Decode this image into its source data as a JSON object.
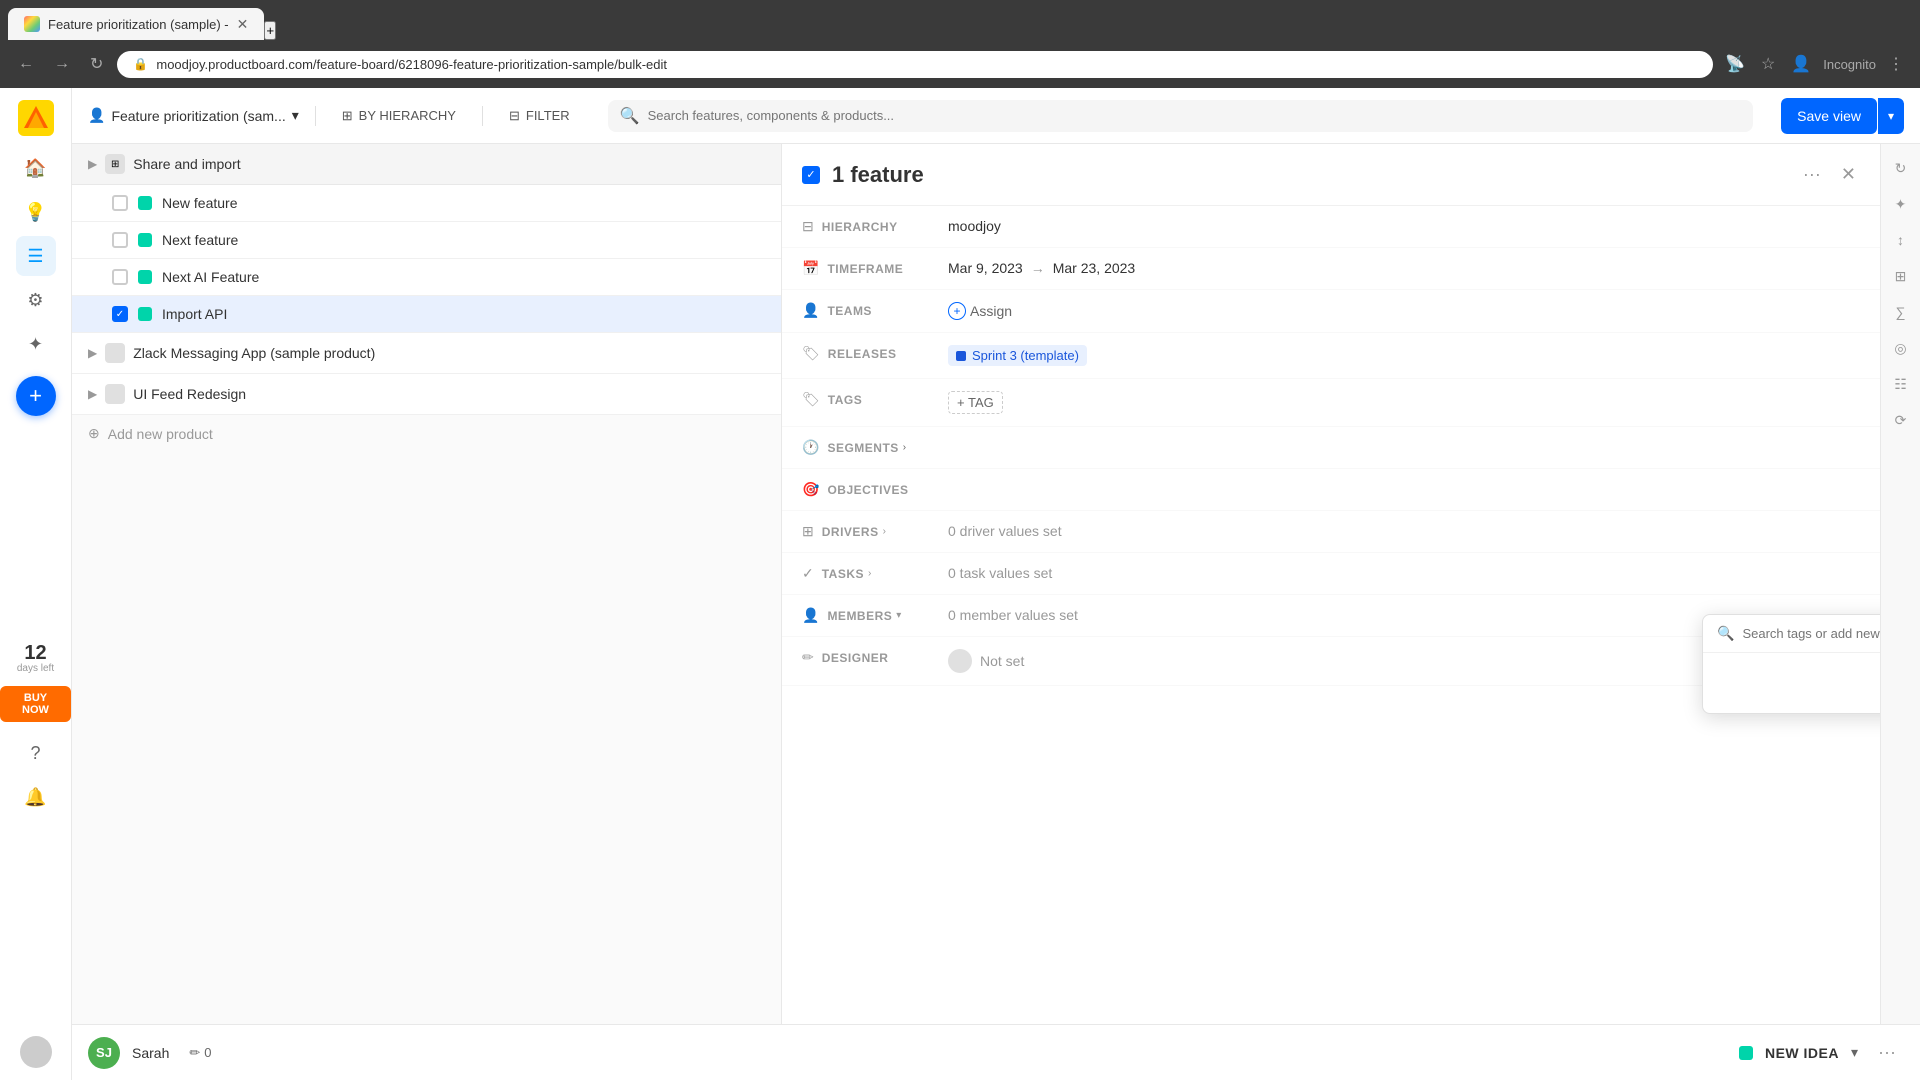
{
  "browser": {
    "tab_title": "Feature prioritization (sample) -",
    "tab_favicon": "🔶",
    "url": "moodjoy.productboard.com/feature-board/6218096-feature-prioritization-sample/bulk-edit",
    "incognito_label": "Incognito"
  },
  "toolbar": {
    "board_name": "Feature prioritization (sam...",
    "hierarchy_label": "BY HIERARCHY",
    "filter_label": "FILTER",
    "search_placeholder": "Search features, components & products...",
    "save_view_label": "Save view"
  },
  "sidebar": {
    "days_left_num": "12",
    "days_left_text": "days left",
    "buy_btn": "BUY NOW"
  },
  "feature_list": {
    "groups": [
      {
        "id": "share-and-import",
        "title": "Share and import",
        "expanded": true,
        "features": [
          {
            "id": "new-feature",
            "name": "New feature",
            "checked": false,
            "selected": false
          },
          {
            "id": "next-feature",
            "name": "Next feature",
            "checked": false,
            "selected": false
          },
          {
            "id": "next-ai-feature",
            "name": "Next AI Feature",
            "checked": false,
            "selected": false
          },
          {
            "id": "import-api",
            "name": "Import API",
            "checked": true,
            "selected": true
          }
        ]
      }
    ],
    "products": [
      {
        "id": "zlack",
        "name": "Zlack Messaging App (sample product)"
      },
      {
        "id": "ui-feed",
        "name": "UI Feed Redesign"
      }
    ],
    "add_product_label": "Add new product"
  },
  "detail": {
    "feature_count": "1 feature",
    "fields": {
      "hierarchy_label": "HIERARCHY",
      "hierarchy_value": "moodjoy",
      "timeframe_label": "TIMEFRAME",
      "timeframe_start": "Mar 9, 2023",
      "timeframe_arrow": "→",
      "timeframe_end": "Mar 23, 2023",
      "teams_label": "TEAMS",
      "teams_assign": "Assign",
      "releases_label": "RELEASES",
      "releases_value": "Sprint 3 (template)",
      "tags_label": "TAGS",
      "tags_btn": "+ TAG",
      "segments_label": "SEGMENTS",
      "objectives_label": "OBJECTIVES",
      "drivers_label": "DRIVERS",
      "drivers_value": "0 driver values set",
      "tasks_label": "TASKS",
      "tasks_value": "0 task values set",
      "members_label": "MEMBERS",
      "members_value": "0 member values set",
      "designer_label": "DESIGNER",
      "designer_value": "Not set"
    },
    "tags_dropdown": {
      "search_placeholder": "Search tags or add new"
    }
  },
  "bottom_bar": {
    "avatar_initials": "SJ",
    "user_name": "Sarah",
    "count_icon": "✏",
    "count_value": "0",
    "new_idea_label": "NEW IDEA"
  },
  "right_sidebar": {
    "icons": [
      "↻",
      "☆",
      "↕",
      "⊞",
      "∑",
      "◎",
      "☷",
      "⟳"
    ]
  }
}
